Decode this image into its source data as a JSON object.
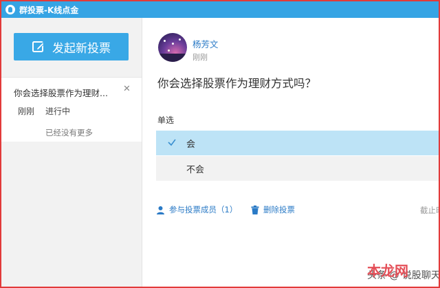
{
  "window": {
    "title": "群投票-K线点金"
  },
  "sidebar": {
    "new_vote_label": "发起新投票",
    "items": [
      {
        "title": "你会选择股票作为理财...",
        "time": "刚刚",
        "status": "进行中"
      }
    ],
    "no_more_label": "已经没有更多"
  },
  "post": {
    "author": "杨芳文",
    "time": "刚刚",
    "question": "你会选择股票作为理财方式吗？",
    "vote_type": "单选",
    "options": [
      {
        "label": "会",
        "selected": true
      },
      {
        "label": "不会",
        "selected": false
      }
    ],
    "participants_label": "参与投票成员（1）",
    "delete_label": "删除投票",
    "deadline_label": "截止时"
  },
  "watermark": {
    "brand": "本龙网",
    "text": "头条 @ 说股聊天"
  },
  "colors": {
    "titlebar": "#36a4e4",
    "accent": "#39a8e6",
    "link": "#2a7ac6",
    "selected_option": "#bde3f6"
  }
}
